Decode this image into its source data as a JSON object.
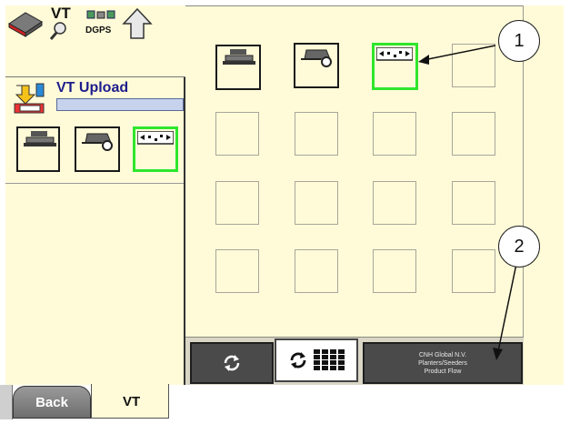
{
  "left_panel": {
    "vt_label": "VT",
    "dgps_label": "DGPS",
    "upload_title": "VT Upload",
    "upload_progress": 0
  },
  "bottom_tabs": {
    "back": "Back",
    "vt": "VT"
  },
  "toolbar": {
    "vendor_line1": "CNH Global N.V.",
    "vendor_line2": "Planters/Seeders",
    "vendor_line3": "Product Flow"
  },
  "callouts": {
    "one": "1",
    "two": "2"
  },
  "colors": {
    "panel_bg": "#fffbd8",
    "selected": "#2ee62e",
    "button": "#4a4a4a"
  },
  "icons": [
    "book-icon",
    "magnifier-icon",
    "satellite-icon",
    "up-arrow-icon",
    "upload-icon",
    "planter-icon",
    "seeder-icon",
    "product-flow-icon",
    "refresh-icon",
    "grid-icon"
  ]
}
